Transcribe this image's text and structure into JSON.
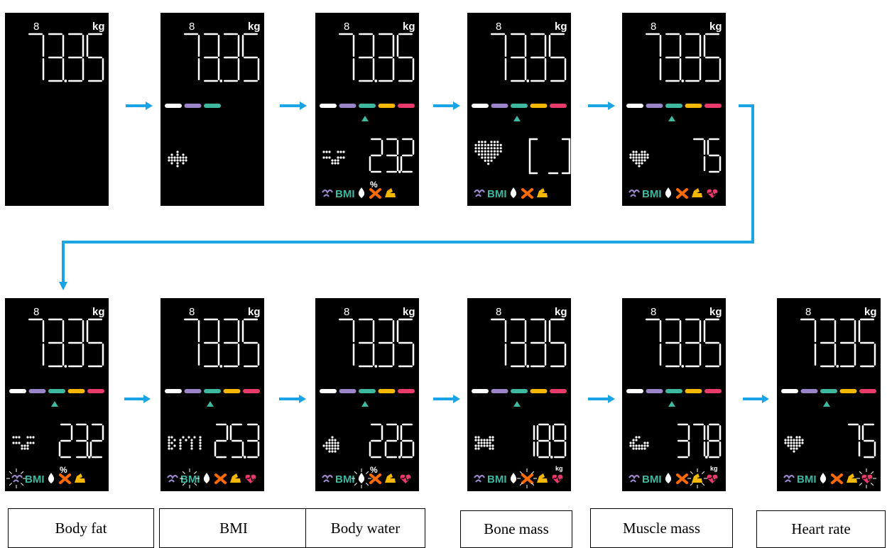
{
  "colors": {
    "flow_arrow": "#1aa3e6",
    "screen_bg": "#000000",
    "bar_segments": [
      "#ffffff",
      "#9b85c9",
      "#3fb8a0",
      "#f5b800",
      "#e83a6b"
    ],
    "indicator": "#3fb8a0",
    "icon_purple": "#9b85c9",
    "icon_teal": "#3fb8a0",
    "icon_orange": "#ff6a00",
    "icon_yellow": "#f5b800",
    "icon_pink": "#e83a6b"
  },
  "display": {
    "user_glyph": "8",
    "unit_kg": "kg",
    "weight": "73.35",
    "bmi_label": "BMI",
    "percent": "%"
  },
  "screens": [
    {
      "row": 0,
      "bars": 0,
      "pointer": false,
      "graphic": "none",
      "value": "",
      "sub": "",
      "icons": 0,
      "highlight": ""
    },
    {
      "row": 0,
      "bars": 3,
      "pointer": false,
      "graphic": "dots",
      "value": "",
      "sub": "",
      "icons": 0,
      "highlight": ""
    },
    {
      "row": 0,
      "bars": 5,
      "pointer": true,
      "graphic": "fat",
      "value": "23.2",
      "sub": "%",
      "icons": 5,
      "highlight": ""
    },
    {
      "row": 0,
      "bars": 5,
      "pointer": true,
      "graphic": "heart-big",
      "value": "[--]",
      "sub": "",
      "icons": 5,
      "highlight": ""
    },
    {
      "row": 0,
      "bars": 5,
      "pointer": true,
      "graphic": "heart",
      "value": "75",
      "sub": "",
      "icons": 6,
      "highlight": ""
    },
    {
      "row": 1,
      "bars": 5,
      "pointer": true,
      "graphic": "fat",
      "value": "23.2",
      "sub": "%",
      "icons": 5,
      "highlight": "fat"
    },
    {
      "row": 1,
      "bars": 5,
      "pointer": true,
      "graphic": "bmi",
      "value": "25.3",
      "sub": "",
      "icons": 6,
      "highlight": "bmi"
    },
    {
      "row": 1,
      "bars": 5,
      "pointer": true,
      "graphic": "drop",
      "value": "22.6",
      "sub": "%",
      "icons": 6,
      "highlight": "water"
    },
    {
      "row": 1,
      "bars": 5,
      "pointer": true,
      "graphic": "bone",
      "value": "18.9",
      "sub": "kg",
      "icons": 6,
      "highlight": "bone"
    },
    {
      "row": 1,
      "bars": 5,
      "pointer": true,
      "graphic": "muscle",
      "value": "37.8",
      "sub": "kg",
      "icons": 6,
      "highlight": "muscle"
    },
    {
      "row": 1,
      "bars": 5,
      "pointer": true,
      "graphic": "heart",
      "value": "75",
      "sub": "",
      "icons": 6,
      "highlight": "heart"
    }
  ],
  "captions": [
    "Body fat",
    "BMI",
    "Body water",
    "Bone mass",
    "Muscle mass",
    "Heart rate"
  ]
}
